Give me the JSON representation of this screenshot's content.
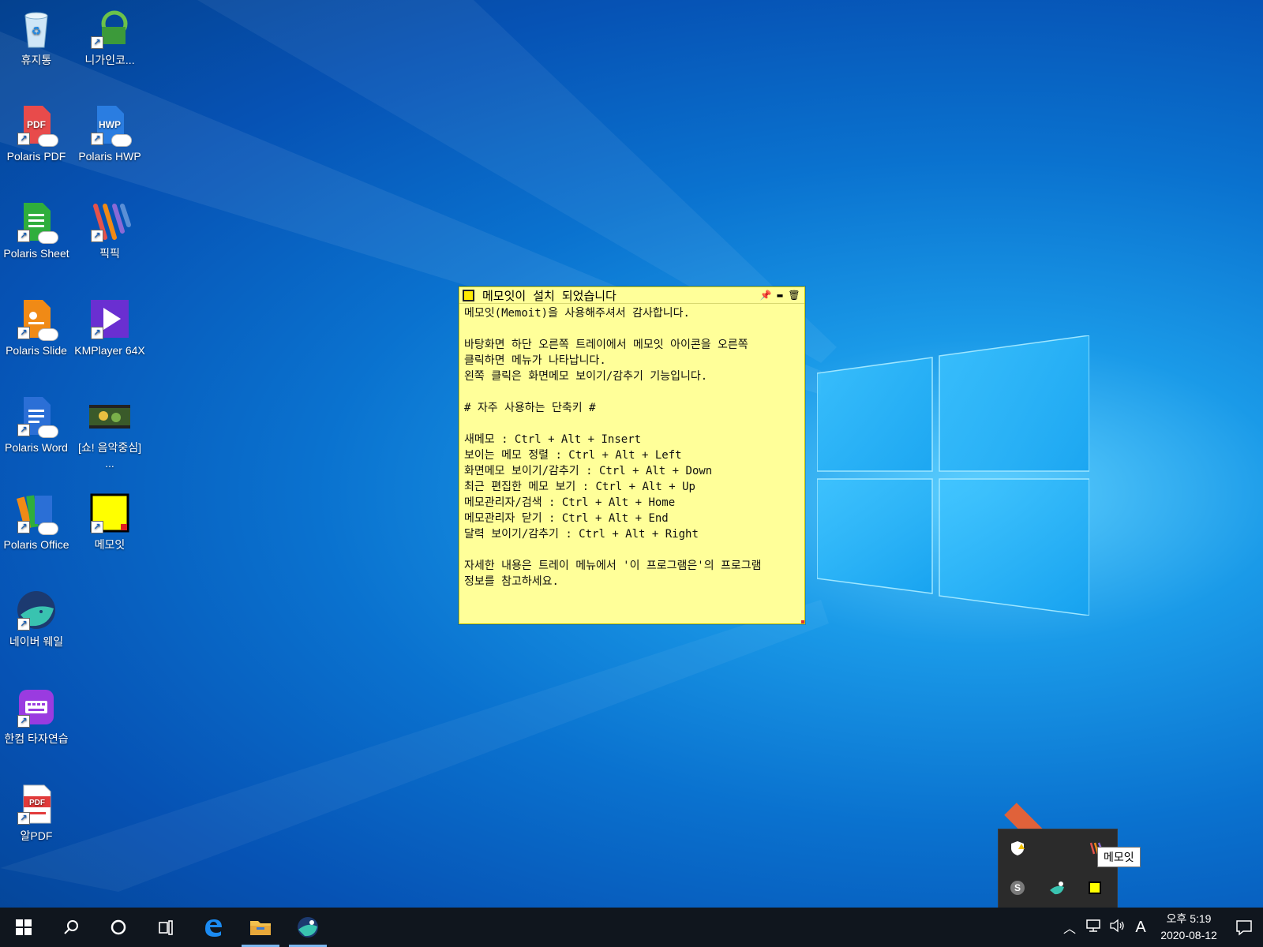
{
  "desktop": {
    "icons": [
      {
        "label": "휴지통",
        "icon": "recycle-bin-icon"
      },
      {
        "label": "니가인코...",
        "icon": "encoder-icon"
      },
      {
        "label": "Polaris PDF",
        "icon": "pdf-icon"
      },
      {
        "label": "Polaris HWP",
        "icon": "hwp-icon"
      },
      {
        "label": "Polaris Sheet",
        "icon": "sheet-icon"
      },
      {
        "label": "픽픽",
        "icon": "picpick-icon"
      },
      {
        "label": "Polaris Slide",
        "icon": "slide-icon"
      },
      {
        "label": "KMPlayer 64X",
        "icon": "kmplayer-icon"
      },
      {
        "label": "Polaris Word",
        "icon": "word-icon"
      },
      {
        "label": "[쇼! 음악중심] ...",
        "icon": "video-thumbnail-icon"
      },
      {
        "label": "Polaris Office",
        "icon": "office-icon"
      },
      {
        "label": "메모잇",
        "icon": "memoit-icon"
      },
      {
        "label": "네이버 웨일",
        "icon": "whale-icon"
      },
      {
        "label": "한컴 타자연습",
        "icon": "typing-icon"
      },
      {
        "label": "알PDF",
        "icon": "alpdf-icon"
      }
    ],
    "icon_colors": {
      "pdf": "#e84b4b",
      "hwp": "#2a7de1",
      "sheet": "#2fae3c",
      "slide": "#f08a16",
      "kmplayer": "#6a2fd1",
      "word": "#2b6fd6",
      "memo_yellow": "#ffff00",
      "typing": "#9a3be0"
    }
  },
  "memo": {
    "title": "메모잇이 설치 되었습니다",
    "body": "메모잇(Memoit)을 사용해주셔서 감사합니다.\n\n바탕화면 하단 오른쪽 트레이에서 메모잇 아이콘을 오른쪽\n클릭하면 메뉴가 나타납니다.\n왼쪽 클릭은 화면메모 보이기/감추기 기능입니다.\n\n# 자주 사용하는 단축키 #\n\n새메모 : Ctrl + Alt + Insert\n보이는 메모 정렬 : Ctrl + Alt + Left\n화면메모 보이기/감추기 : Ctrl + Alt + Down\n최근 편집한 메모 보기 : Ctrl + Alt + Up\n메모관리자/검색 : Ctrl + Alt + Home\n메모관리자 닫기 : Ctrl + Alt + End\n달력 보이기/감추기 : Ctrl + Alt + Right\n\n자세한 내용은 트레이 메뉴에서 '이 프로그램은'의 프로그램\n정보를 참고하세요.",
    "background": "#ffff99"
  },
  "tray_popup": {
    "tooltip": "메모잇",
    "icons": [
      "security-warning-icon",
      "picpick-tray-icon",
      "skype-icon",
      "whale-tray-icon",
      "memoit-tray-icon"
    ]
  },
  "taskbar": {
    "buttons": [
      "start-icon",
      "search-icon",
      "cortana-icon",
      "task-view-icon",
      "edge-icon",
      "file-explorer-icon",
      "whale-icon"
    ],
    "ime": "A",
    "time": "오후 5:19",
    "date": "2020-08-12",
    "background": "#10161e"
  }
}
